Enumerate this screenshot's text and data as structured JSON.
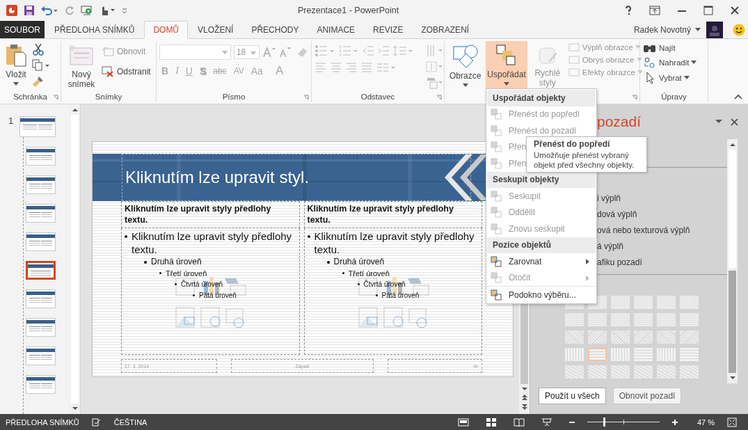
{
  "title_bar": {
    "title": "Prezentace1 - PowerPoint"
  },
  "tabs": [
    {
      "label": "SOUBOR",
      "kind": "file",
      "selected": false
    },
    {
      "label": "PŘEDLOHA SNÍMKŮ",
      "kind": "tab",
      "selected": false
    },
    {
      "label": "DOMŮ",
      "kind": "tab",
      "selected": true
    },
    {
      "label": "VLOŽENÍ",
      "kind": "tab",
      "selected": false
    },
    {
      "label": "PŘECHODY",
      "kind": "tab",
      "selected": false
    },
    {
      "label": "ANIMACE",
      "kind": "tab",
      "selected": false
    },
    {
      "label": "REVIZE",
      "kind": "tab",
      "selected": false
    },
    {
      "label": "ZOBRAZENÍ",
      "kind": "tab",
      "selected": false
    }
  ],
  "user": {
    "name": "Radek Novotný"
  },
  "ribbon": {
    "clipboard": {
      "label": "Schránka",
      "paste": "Vložit"
    },
    "slides": {
      "label": "Snímky",
      "new_slide": "Nový snímek",
      "reset": {
        "label": "Obnovit",
        "disabled": true
      },
      "delete": {
        "label": "Odstranit",
        "disabled": false
      }
    },
    "font": {
      "label": "Písmo",
      "size": "18",
      "disabled": true,
      "buttons": [
        {
          "label": "B"
        },
        {
          "label": "I"
        },
        {
          "label": "U"
        },
        {
          "label": "S"
        },
        {
          "label": "abc"
        },
        {
          "label": "AV"
        },
        {
          "label": "Aa"
        },
        {
          "label": "A"
        }
      ]
    },
    "paragraph": {
      "label": "Odstavec"
    },
    "drawing": {
      "shapes": "Obrazce",
      "arrange": {
        "label": "Uspořádat",
        "pressed": true
      },
      "quick_styles": {
        "label": "Rychlé styly",
        "disabled": true
      },
      "commands": [
        {
          "label": "Výplň obrazce",
          "disabled": true
        },
        {
          "label": "Obrys obrazce",
          "disabled": true
        },
        {
          "label": "Efekty obrazce",
          "disabled": true
        }
      ]
    },
    "editing": {
      "label": "Úpravy",
      "find": "Najít",
      "replace": "Nahradit",
      "select": "Vybrat"
    }
  },
  "thumbnails": {
    "number": "1",
    "slides": [
      {
        "selected": false
      },
      {
        "selected": false
      },
      {
        "selected": false
      },
      {
        "selected": false
      },
      {
        "selected": false
      },
      {
        "selected": true
      },
      {
        "selected": false
      },
      {
        "selected": false
      },
      {
        "selected": false
      },
      {
        "selected": false
      }
    ]
  },
  "slide": {
    "title": "Kliknutím lze upravit styl.",
    "columns": [
      {
        "heading": "Kliknutím lze upravit styly předlohy textu.",
        "items": [
          {
            "text": "Kliknutím lze upravit styly předlohy textu.",
            "children": [
              {
                "text": "Druhá úroveň",
                "children": [
                  {
                    "text": "Třetí úroveň",
                    "children": [
                      {
                        "text": "Čtvrtá úroveň",
                        "children": [
                          {
                            "text": "Pátá úroveň"
                          }
                        ]
                      }
                    ]
                  }
                ]
              }
            ]
          }
        ]
      },
      {
        "heading": "Kliknutím lze upravit styly předlohy textu.",
        "items": [
          {
            "text": "Kliknutím lze upravit styly předlohy textu.",
            "children": [
              {
                "text": "Druhá úroveň",
                "children": [
                  {
                    "text": "Třetí úroveň",
                    "children": [
                      {
                        "text": "Čtvrtá úroveň",
                        "children": [
                          {
                            "text": "Pátá úroveň"
                          }
                        ]
                      }
                    ]
                  }
                ]
              }
            ]
          }
        ]
      }
    ],
    "footer": {
      "date": "17. 3. 2014",
      "text": "Zápatí",
      "number": "‹#›"
    }
  },
  "format_pane": {
    "title": "pozadí",
    "options": [
      "i výplň",
      "dová výplň",
      "ová nebo texturová výplň",
      "á výplň",
      "afiku pozadí"
    ],
    "patterns": [
      {
        "selected": false
      },
      {
        "selected": false
      },
      {
        "selected": false
      },
      {
        "selected": false
      },
      {
        "selected": false
      },
      {
        "selected": false
      },
      {
        "selected": false
      },
      {
        "selected": false
      },
      {
        "selected": false
      },
      {
        "selected": false
      },
      {
        "selected": false
      },
      {
        "selected": false
      },
      {
        "selected": false
      },
      {
        "selected": false
      },
      {
        "selected": false
      },
      {
        "selected": false
      },
      {
        "selected": false
      },
      {
        "selected": false
      },
      {
        "selected": false
      },
      {
        "selected": true
      },
      {
        "selected": false
      },
      {
        "selected": false
      },
      {
        "selected": false
      },
      {
        "selected": false
      },
      {
        "selected": false
      },
      {
        "selected": false
      },
      {
        "selected": false
      },
      {
        "selected": false
      },
      {
        "selected": false
      },
      {
        "selected": false
      }
    ],
    "buttons": [
      {
        "label": "Použít u všech",
        "disabled": false
      },
      {
        "label": "Obnovit pozadí",
        "disabled": true
      }
    ]
  },
  "arrange_menu": {
    "sections": [
      {
        "heading": "Uspořádat objekty",
        "items": [
          {
            "label": "Přenést do popředí",
            "disabled": true,
            "submenu": false
          },
          {
            "label": "Přenést do pozadí",
            "disabled": true,
            "submenu": false
          },
          {
            "label": "Přen",
            "disabled": true,
            "submenu": false
          },
          {
            "label": "Přen",
            "disabled": true,
            "submenu": false
          }
        ]
      },
      {
        "heading": "Seskupit objekty",
        "items": [
          {
            "label": "Seskupit",
            "disabled": true,
            "submenu": false
          },
          {
            "label": "Oddělit",
            "disabled": true,
            "submenu": false
          },
          {
            "label": "Znovu seskupit",
            "disabled": true,
            "submenu": false
          }
        ]
      },
      {
        "heading": "Pozice objektů",
        "items": [
          {
            "label": "Zarovnat",
            "disabled": false,
            "submenu": true
          },
          {
            "label": "Otočit",
            "disabled": true,
            "submenu": true
          },
          {
            "label": "Podokno výběru...",
            "disabled": false,
            "submenu": false
          }
        ]
      }
    ]
  },
  "tooltip": {
    "title": "Přenést do popředí",
    "text": "Umožňuje přenést vybraný objekt před všechny objekty."
  },
  "status_bar": {
    "view": "PŘEDLOHA SNÍMKŮ",
    "language": "ČEŠTINA",
    "zoom": "47 %",
    "zoom_level": {
      "level": 0.22
    }
  }
}
